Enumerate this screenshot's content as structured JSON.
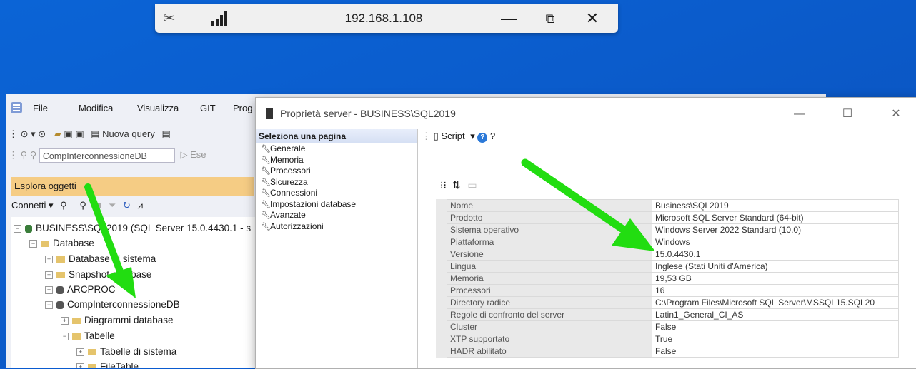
{
  "remote_bar": {
    "ip": "192.168.1.108",
    "min": "—",
    "max": "⧉",
    "close": "✕"
  },
  "ssms": {
    "menu": [
      "File",
      "Modifica",
      "Visualizza",
      "GIT",
      "Prog"
    ],
    "toolbar": {
      "new_query": "Nuova query",
      "database": "CompInterconnessioneDB",
      "execute": "Ese"
    },
    "object_explorer": {
      "title": "Esplora oggetti",
      "connect": "Connetti",
      "tree": [
        {
          "label": "BUSINESS\\SQL2019 (SQL Server 15.0.4430.1 - s",
          "level": 0,
          "icon": "server"
        },
        {
          "label": "Database",
          "level": 1,
          "icon": "folder"
        },
        {
          "label": "Database di sistema",
          "level": 2,
          "icon": "folder"
        },
        {
          "label": "Snapshot database",
          "level": 2,
          "icon": "folder"
        },
        {
          "label": "ARCPROC",
          "level": 2,
          "icon": "database"
        },
        {
          "label": "CompInterconnessioneDB",
          "level": 2,
          "icon": "database"
        },
        {
          "label": "Diagrammi database",
          "level": 3,
          "icon": "folder"
        },
        {
          "label": "Tabelle",
          "level": 3,
          "icon": "folder"
        },
        {
          "label": "Tabelle di sistema",
          "level": 4,
          "icon": "folder"
        },
        {
          "label": "FileTable",
          "level": 4,
          "icon": "folder"
        }
      ]
    }
  },
  "dialog": {
    "title": "Proprietà server - BUSINESS\\SQL2019",
    "pages_header": "Seleziona una pagina",
    "pages": [
      "Generale",
      "Memoria",
      "Processori",
      "Sicurezza",
      "Connessioni",
      "Impostazioni database",
      "Avanzate",
      "Autorizzazioni"
    ],
    "script_label": "Script",
    "help": "?",
    "properties": [
      {
        "name": "Nome",
        "value": "Business\\SQL2019"
      },
      {
        "name": "Prodotto",
        "value": "Microsoft SQL Server Standard (64-bit)"
      },
      {
        "name": "Sistema operativo",
        "value": "Windows Server 2022 Standard (10.0)"
      },
      {
        "name": "Piattaforma",
        "value": "Windows"
      },
      {
        "name": "Versione",
        "value": "15.0.4430.1"
      },
      {
        "name": "Lingua",
        "value": "Inglese (Stati Uniti d'America)"
      },
      {
        "name": "Memoria",
        "value": "19,53 GB"
      },
      {
        "name": "Processori",
        "value": "16"
      },
      {
        "name": "Directory radice",
        "value": "C:\\Program Files\\Microsoft SQL Server\\MSSQL15.SQL20"
      },
      {
        "name": "Regole di confronto del server",
        "value": "Latin1_General_CI_AS"
      },
      {
        "name": "Cluster",
        "value": "False"
      },
      {
        "name": "XTP supportato",
        "value": "True"
      },
      {
        "name": "HADR abilitato",
        "value": "False"
      }
    ]
  },
  "colors": {
    "arrow": "#22dd11",
    "desktop": "#0b5ccc",
    "oe_header": "#f5cc84"
  }
}
